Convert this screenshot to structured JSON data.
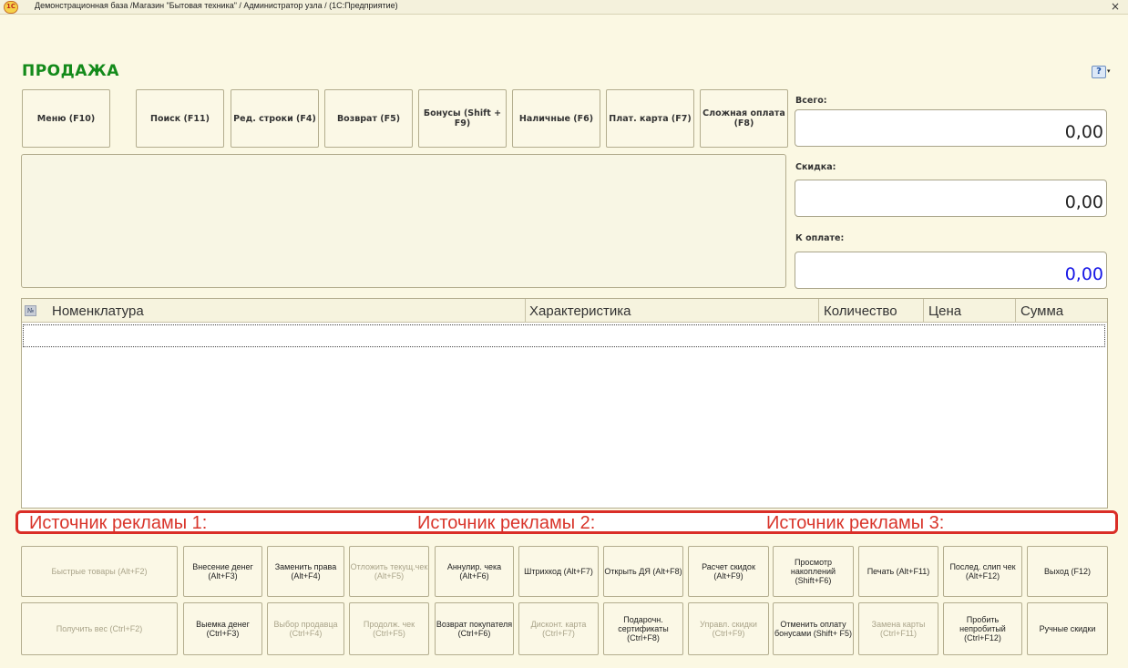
{
  "window": {
    "title": "Демонстрационная база /Магазин \"Бытовая техника\" / Администратор узла / (1С:Предприятие)",
    "logo_text": "1С",
    "close_glyph": "×"
  },
  "page": {
    "heading": "ПРОДАЖА",
    "help_glyph": "?",
    "help_arrow": "▾"
  },
  "toolbar": [
    {
      "key": "menu",
      "label": "Меню (F10)"
    },
    {
      "key": "search",
      "label": "Поиск (F11)"
    },
    {
      "key": "edit-row",
      "label": "Ред. строки (F4)"
    },
    {
      "key": "return",
      "label": "Возврат (F5)"
    },
    {
      "key": "bonus",
      "label": "Бонусы (Shift + F9)"
    },
    {
      "key": "cash",
      "label": "Наличные (F6)"
    },
    {
      "key": "card",
      "label": "Плат. карта (F7)"
    },
    {
      "key": "complex",
      "label": "Сложная оплата (F8)"
    }
  ],
  "totals": {
    "total_label": "Всего:",
    "total_value": "0,00",
    "discount_label": "Скидка:",
    "discount_value": "0,00",
    "pay_label": "К оплате:",
    "pay_value": "0,00",
    "pay_color": "#1616e6"
  },
  "table": {
    "no_header": "№",
    "columns": [
      "Номенклатура",
      "Характеристика",
      "Количество",
      "Цена",
      "Сумма"
    ]
  },
  "ads": [
    "Источник рекламы 1:",
    "Источник рекламы 2:",
    "Источник рекламы 3:"
  ],
  "keys_row1": [
    {
      "label": "Быстрые товары (Alt+F2)",
      "disabled": true
    },
    {
      "label": "Внесение денег (Alt+F3)",
      "disabled": false
    },
    {
      "label": "Заменить права (Alt+F4)",
      "disabled": false
    },
    {
      "label": "Отложить текущ.чек (Alt+F5)",
      "disabled": true
    },
    {
      "label": "Аннулир. чека (Alt+F6)",
      "disabled": false
    },
    {
      "label": "Штрихкод (Alt+F7)",
      "disabled": false
    },
    {
      "label": "Открыть ДЯ (Alt+F8)",
      "disabled": false
    },
    {
      "label": "Расчет скидок (Alt+F9)",
      "disabled": false
    },
    {
      "label": "Просмотр накоплений (Shift+F6)",
      "disabled": false
    },
    {
      "label": "Печать (Alt+F11)",
      "disabled": false
    },
    {
      "label": "Послед. слип чек (Alt+F12)",
      "disabled": false
    },
    {
      "label": "Выход (F12)",
      "disabled": false
    }
  ],
  "keys_row2": [
    {
      "label": "Получить вес (Ctrl+F2)",
      "disabled": true
    },
    {
      "label": "Выемка денег (Ctrl+F3)",
      "disabled": false
    },
    {
      "label": "Выбор продавца (Ctrl+F4)",
      "disabled": true
    },
    {
      "label": "Продолж. чек (Ctrl+F5)",
      "disabled": true
    },
    {
      "label": "Возврат покупателя (Ctrl+F6)",
      "disabled": false
    },
    {
      "label": "Дисконт. карта (Ctrl+F7)",
      "disabled": true
    },
    {
      "label": "Подарочн. сертификаты (Ctrl+F8)",
      "disabled": false
    },
    {
      "label": "Управл. скидки (Ctrl+F9)",
      "disabled": true
    },
    {
      "label": "Отменить оплату бонусами (Shift+ F5)",
      "disabled": false
    },
    {
      "label": "Замена карты (Ctrl+F11)",
      "disabled": true
    },
    {
      "label": "Пробить непробитый (Ctrl+F12)",
      "disabled": false
    },
    {
      "label": "Ручные скидки",
      "disabled": false
    }
  ]
}
